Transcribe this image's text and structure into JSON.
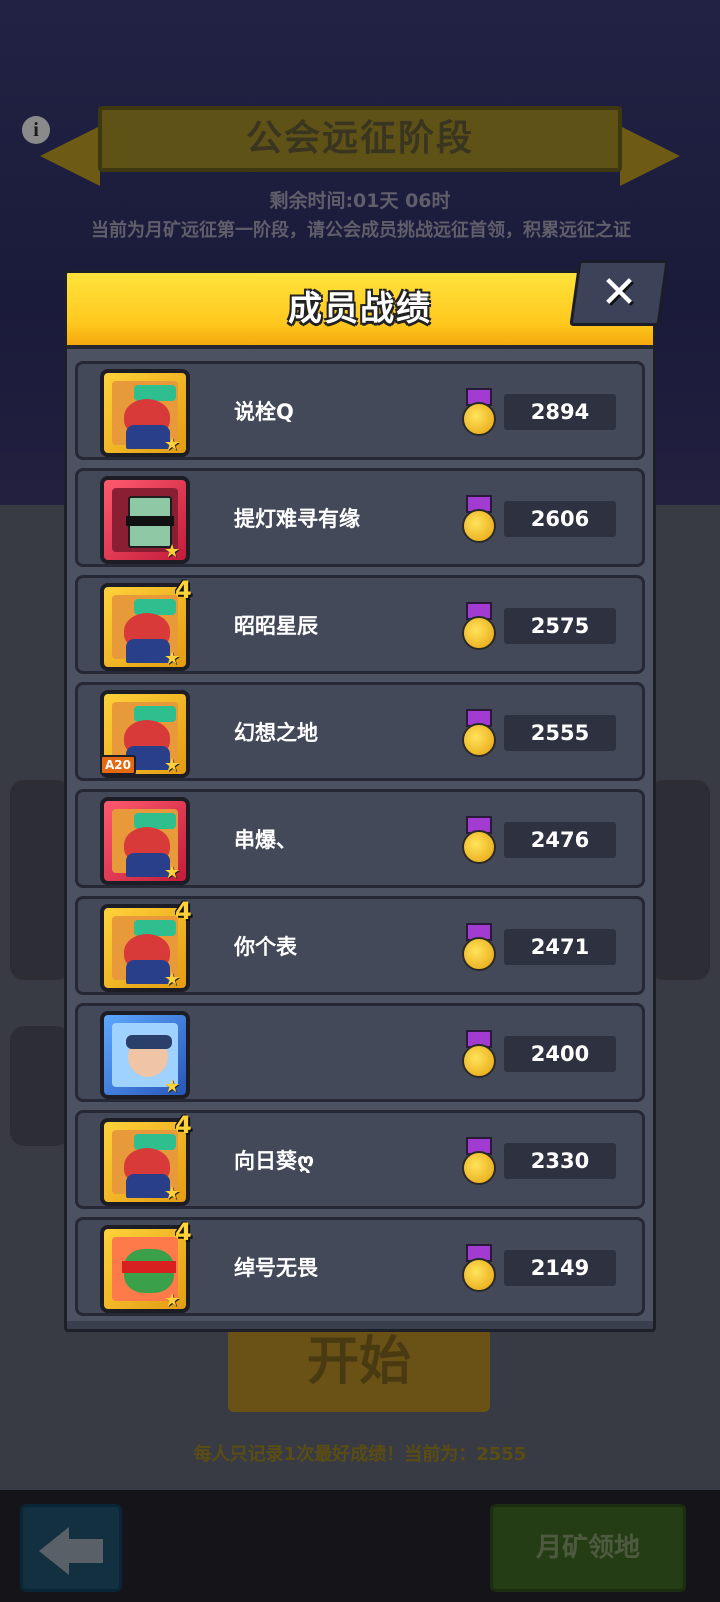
{
  "background": {
    "stage_title": "公会远征阶段",
    "remaining_time": "剩余时间:01天 06时",
    "description": "当前为月矿远征第一阶段，请公会成员挑战远征首领，积累远征之证",
    "start_label": "开始",
    "best_note": "每人只记录1次最好成绩！当前为：2555",
    "moon_button_label": "月矿领地"
  },
  "modal": {
    "title": "成员战绩",
    "close_glyph": "✕",
    "members": [
      {
        "name": "说栓Q",
        "score": "2894",
        "frame": "gold",
        "badge": "",
        "avatar": "hero"
      },
      {
        "name": "提灯难寻有缘",
        "score": "2606",
        "frame": "red",
        "badge": "",
        "avatar": "zombie"
      },
      {
        "name": "昭昭星辰",
        "score": "2575",
        "frame": "gold",
        "badge": "4",
        "avatar": "hero"
      },
      {
        "name": "幻想之地",
        "score": "2555",
        "frame": "gold",
        "badge": "A20",
        "avatar": "hero"
      },
      {
        "name": "串爆、",
        "score": "2476",
        "frame": "red",
        "badge": "",
        "avatar": "hero"
      },
      {
        "name": "你个表",
        "score": "2471",
        "frame": "gold",
        "badge": "4",
        "avatar": "hero"
      },
      {
        "name": "",
        "score": "2400",
        "frame": "blue",
        "badge": "",
        "avatar": "blue"
      },
      {
        "name": "向日葵ღ",
        "score": "2330",
        "frame": "gold",
        "badge": "4",
        "avatar": "hero"
      },
      {
        "name": "绰号无畏",
        "score": "2149",
        "frame": "gold",
        "badge": "4",
        "avatar": "turtle"
      }
    ]
  }
}
